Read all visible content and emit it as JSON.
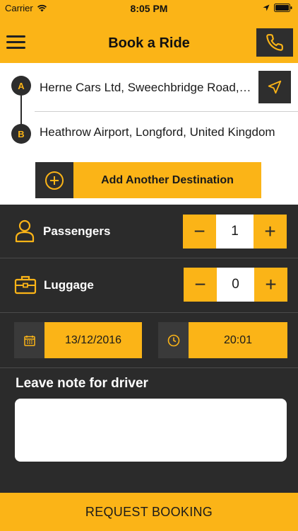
{
  "status_bar": {
    "carrier": "Carrier",
    "time": "8:05 PM"
  },
  "header": {
    "title": "Book a Ride"
  },
  "route": {
    "pickup_marker": "A",
    "pickup_address": "Herne Cars Ltd, Sweechbridge Road, Herne Bay",
    "dropoff_marker": "B",
    "dropoff_address": "Heathrow Airport, Longford, United Kingdom"
  },
  "add_destination": {
    "label": "Add Another Destination"
  },
  "passengers": {
    "label": "Passengers",
    "value": "1",
    "minus": "−",
    "plus": "+"
  },
  "luggage": {
    "label": "Luggage",
    "value": "0",
    "minus": "−",
    "plus": "+"
  },
  "booking": {
    "date": "13/12/2016",
    "time": "20:01"
  },
  "note": {
    "title": "Leave note for driver",
    "value": ""
  },
  "request": {
    "label": "REQUEST BOOKING"
  },
  "colors": {
    "accent": "#fbb417",
    "dark": "#2b2b2b",
    "white": "#ffffff"
  },
  "icons": [
    "wifi-icon",
    "location-arrow-icon",
    "battery-icon",
    "menu-icon",
    "phone-icon",
    "send-location-icon",
    "plus-circle-icon",
    "person-icon",
    "briefcase-icon",
    "calendar-icon",
    "clock-icon"
  ]
}
